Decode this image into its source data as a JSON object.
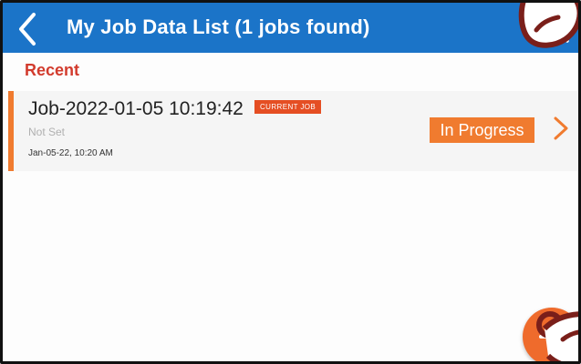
{
  "appbar": {
    "title": "My Job Data List (1 jobs found)",
    "back_icon": "back-arrow-icon",
    "search_icon": "search-icon",
    "color": "#1b74c8"
  },
  "section": {
    "label": "Recent"
  },
  "jobs": [
    {
      "title": "Job-2022-01-05 10:19:42",
      "tag": "CURRENT JOB",
      "subtitle": "Not Set",
      "date": "Jan-05-22, 10:20 AM",
      "status": "In Progress",
      "accent": "#f07b2f"
    }
  ],
  "fab": {
    "icon": "add-icon",
    "color": "#ef6b2c"
  }
}
